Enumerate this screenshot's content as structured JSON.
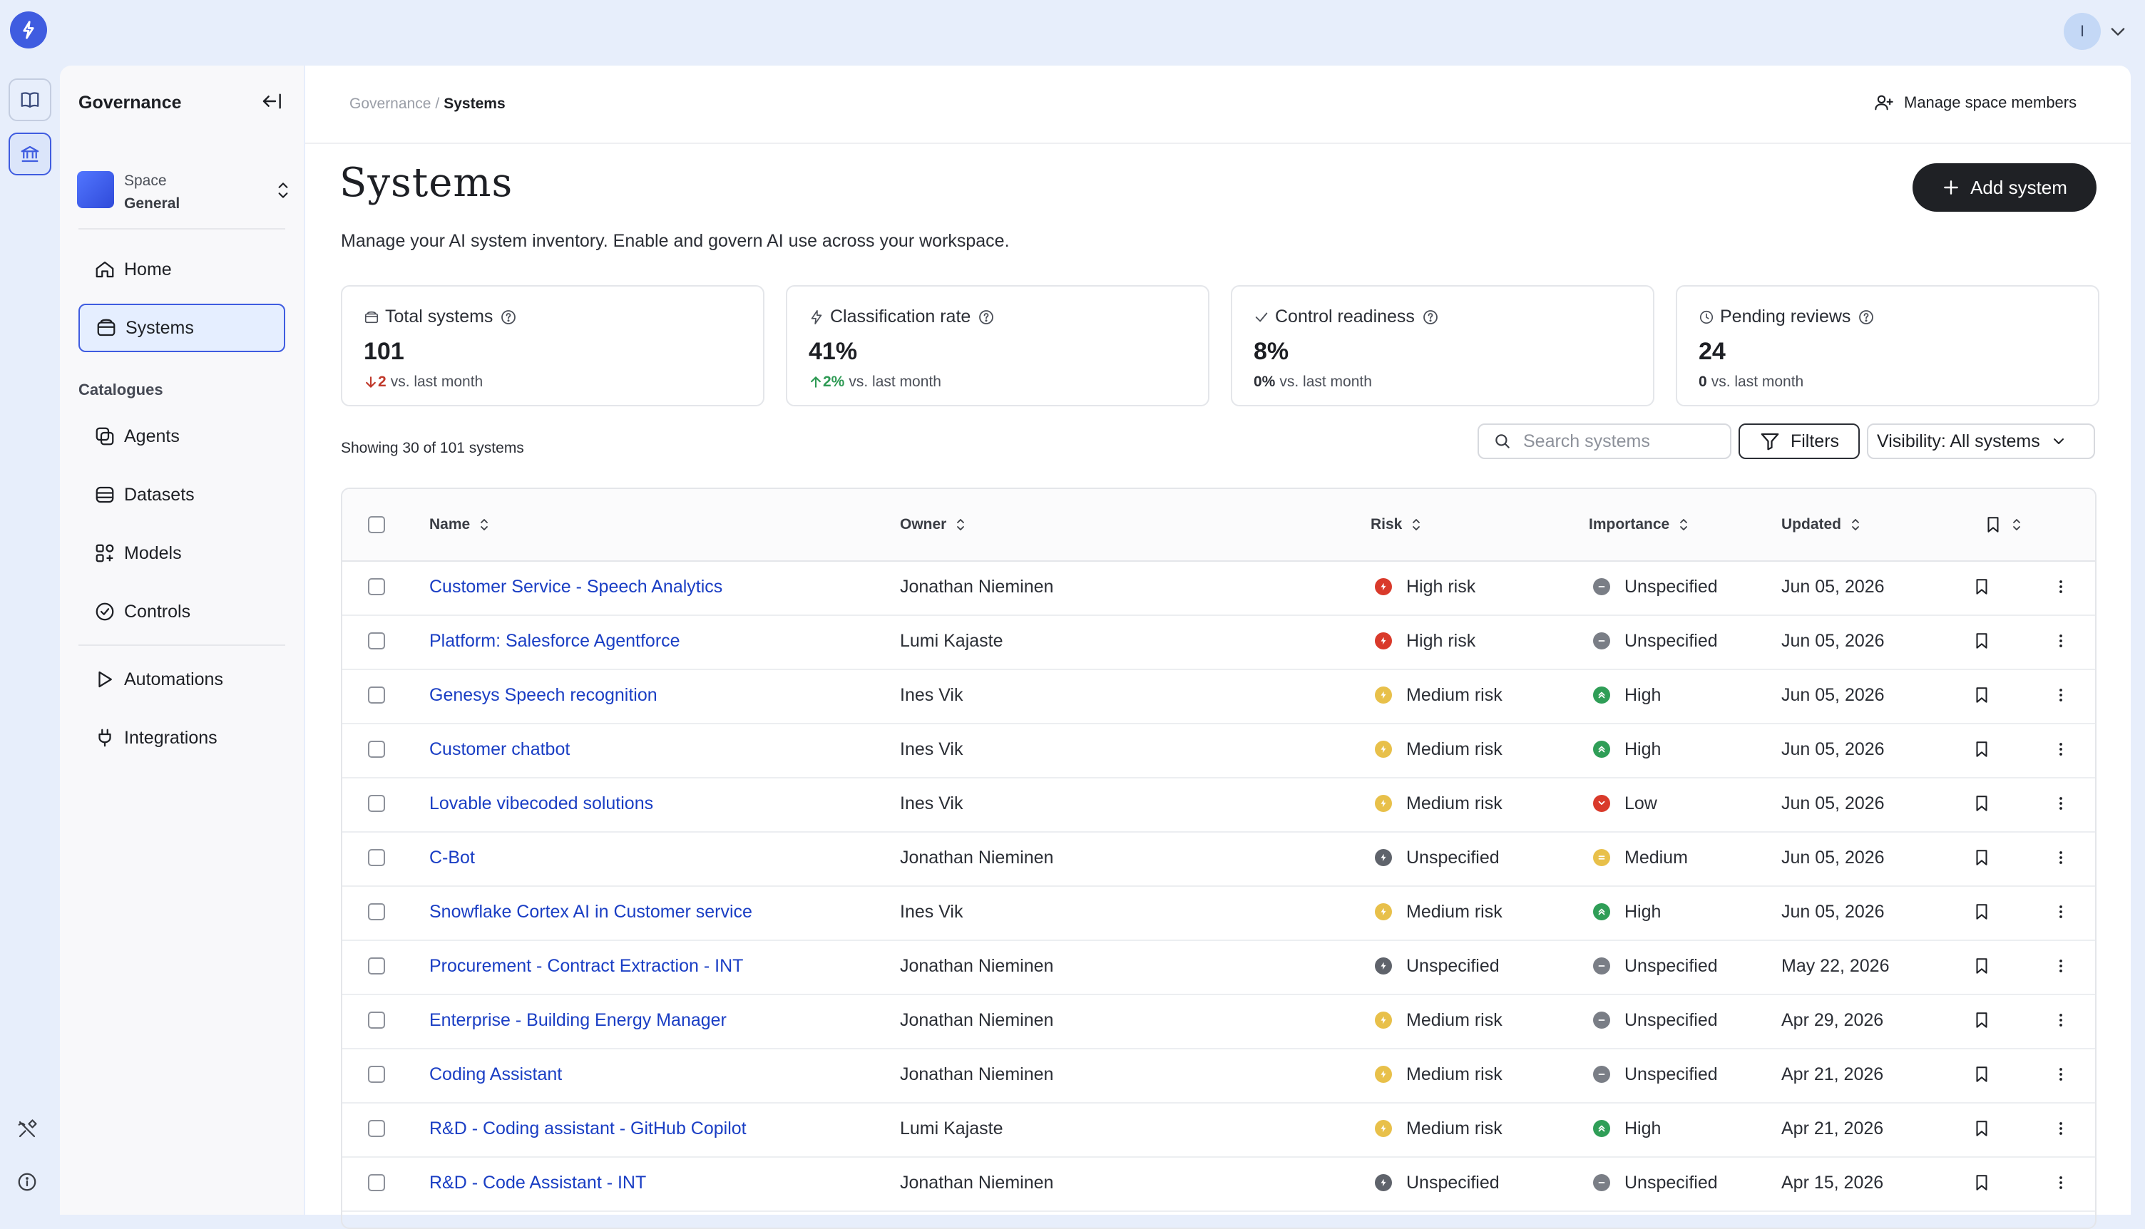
{
  "colors": {
    "accent": "#3f5ce0",
    "link": "#1a3ec4",
    "risk_high": "#d93a2b",
    "risk_medium": "#e8c04a",
    "risk_unspecified": "#5f636b",
    "importance_high": "#2f9e57",
    "importance_low": "#d93a2b",
    "importance_medium": "#e8c04a",
    "importance_unspecified": "#7a7e86",
    "delta_down": "#c0392b",
    "delta_up": "#2e9a54"
  },
  "user": {
    "avatar_initial": "I"
  },
  "sidebar": {
    "title": "Governance",
    "space": {
      "label": "Space",
      "name": "General"
    },
    "nav": [
      {
        "label": "Home",
        "icon": "home-icon"
      },
      {
        "label": "Systems",
        "icon": "systems-icon",
        "active": true
      }
    ],
    "catalogues_heading": "Catalogues",
    "catalogues": [
      {
        "label": "Agents",
        "icon": "agents-icon"
      },
      {
        "label": "Datasets",
        "icon": "datasets-icon"
      },
      {
        "label": "Models",
        "icon": "models-icon"
      },
      {
        "label": "Controls",
        "icon": "controls-icon"
      }
    ],
    "extras": [
      {
        "label": "Automations",
        "icon": "play-icon"
      },
      {
        "label": "Integrations",
        "icon": "plug-icon"
      }
    ]
  },
  "breadcrumb": {
    "parent": "Governance",
    "separator": "/",
    "current": "Systems"
  },
  "header": {
    "manage_members": "Manage space members"
  },
  "page": {
    "title": "Systems",
    "add_button": "Add system",
    "subtitle": "Manage your AI system inventory. Enable and govern AI use across your workspace."
  },
  "stats": [
    {
      "label": "Total systems",
      "icon": "box-icon",
      "value": "101",
      "delta": "2",
      "delta_dir": "down",
      "delta_suffix": "vs. last month"
    },
    {
      "label": "Classification rate",
      "icon": "bolt-icon",
      "value": "41%",
      "delta": "2%",
      "delta_dir": "up",
      "delta_suffix": "vs. last month"
    },
    {
      "label": "Control readiness",
      "icon": "check-icon",
      "value": "8%",
      "delta": "0%",
      "delta_dir": "flat",
      "delta_suffix": "vs. last month"
    },
    {
      "label": "Pending reviews",
      "icon": "clock-icon",
      "value": "24",
      "delta": "0",
      "delta_dir": "flat",
      "delta_suffix": "vs. last month"
    }
  ],
  "toolbar": {
    "showing": "Showing 30 of 101 systems",
    "search_placeholder": "Search systems",
    "filters": "Filters",
    "visibility": "Visibility: All systems"
  },
  "table": {
    "columns": {
      "name": "Name",
      "owner": "Owner",
      "risk": "Risk",
      "importance": "Importance",
      "updated": "Updated"
    },
    "rows": [
      {
        "name": "Customer Service - Speech Analytics",
        "owner": "Jonathan Nieminen",
        "risk": "High risk",
        "risk_level": "high",
        "importance": "Unspecified",
        "importance_level": "unspecified",
        "updated": "Jun 05, 2026"
      },
      {
        "name": "Platform: Salesforce Agentforce",
        "owner": "Lumi Kajaste",
        "risk": "High risk",
        "risk_level": "high",
        "importance": "Unspecified",
        "importance_level": "unspecified",
        "updated": "Jun 05, 2026"
      },
      {
        "name": "Genesys Speech recognition",
        "owner": "Ines Vik",
        "risk": "Medium risk",
        "risk_level": "medium",
        "importance": "High",
        "importance_level": "high",
        "updated": "Jun 05, 2026"
      },
      {
        "name": "Customer chatbot",
        "owner": "Ines Vik",
        "risk": "Medium risk",
        "risk_level": "medium",
        "importance": "High",
        "importance_level": "high",
        "updated": "Jun 05, 2026"
      },
      {
        "name": "Lovable vibecoded solutions",
        "owner": "Ines Vik",
        "risk": "Medium risk",
        "risk_level": "medium",
        "importance": "Low",
        "importance_level": "low",
        "updated": "Jun 05, 2026"
      },
      {
        "name": "C-Bot",
        "owner": "Jonathan Nieminen",
        "risk": "Unspecified",
        "risk_level": "unspecified",
        "importance": "Medium",
        "importance_level": "medium",
        "updated": "Jun 05, 2026"
      },
      {
        "name": "Snowflake Cortex AI in Customer service",
        "owner": "Ines Vik",
        "risk": "Medium risk",
        "risk_level": "medium",
        "importance": "High",
        "importance_level": "high",
        "updated": "Jun 05, 2026"
      },
      {
        "name": "Procurement - Contract Extraction - INT",
        "owner": "Jonathan Nieminen",
        "risk": "Unspecified",
        "risk_level": "unspecified",
        "importance": "Unspecified",
        "importance_level": "unspecified",
        "updated": "May 22, 2026"
      },
      {
        "name": "Enterprise - Building Energy Manager",
        "owner": "Jonathan Nieminen",
        "risk": "Medium risk",
        "risk_level": "medium",
        "importance": "Unspecified",
        "importance_level": "unspecified",
        "updated": "Apr 29, 2026"
      },
      {
        "name": "Coding Assistant",
        "owner": "Jonathan Nieminen",
        "risk": "Medium risk",
        "risk_level": "medium",
        "importance": "Unspecified",
        "importance_level": "unspecified",
        "updated": "Apr 21, 2026"
      },
      {
        "name": "R&D - Coding assistant - GitHub Copilot",
        "owner": "Lumi Kajaste",
        "risk": "Medium risk",
        "risk_level": "medium",
        "importance": "High",
        "importance_level": "high",
        "updated": "Apr 21, 2026"
      },
      {
        "name": "R&D - Code Assistant - INT",
        "owner": "Jonathan Nieminen",
        "risk": "Unspecified",
        "risk_level": "unspecified",
        "importance": "Unspecified",
        "importance_level": "unspecified",
        "updated": "Apr 15, 2026"
      }
    ]
  }
}
